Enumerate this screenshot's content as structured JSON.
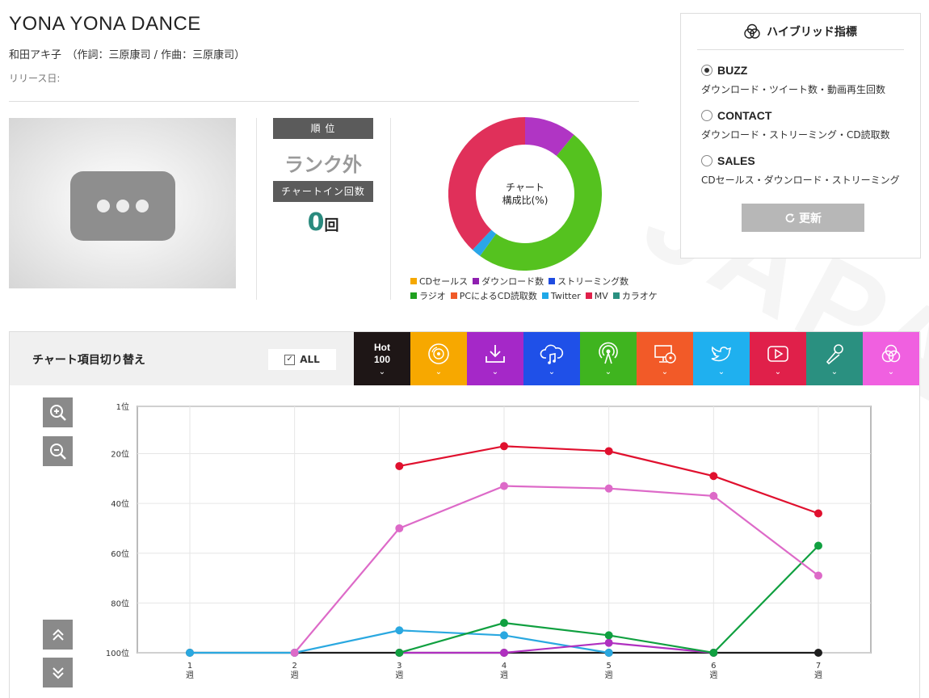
{
  "watermark": "JAPAN",
  "song": {
    "title": "YONA YONA DANCE",
    "credits": "和田アキ子　（作詞：三原康司 / 作曲：三原康司）",
    "release_label": "リリース日:"
  },
  "rank": {
    "header": "順 位",
    "value": "ランク外",
    "chartin_header": "チャートイン回数",
    "chartin_count": "0",
    "chartin_unit": "回"
  },
  "composition": {
    "center_line1": "チャート",
    "center_line2": "構成比(%)",
    "slices": [
      {
        "name": "ダウンロード数",
        "value": 11,
        "color": "#b035c4"
      },
      {
        "name": "ラジオ",
        "value": 49,
        "color": "#55c21f"
      },
      {
        "name": "Twitter",
        "value": 2,
        "color": "#2aa6e8"
      },
      {
        "name": "MV",
        "value": 38,
        "color": "#e0305a"
      }
    ],
    "legend": [
      [
        {
          "label": "CDセールス",
          "color": "#f5a800"
        },
        {
          "label": "ダウンロード数",
          "color": "#8f1fb0"
        },
        {
          "label": "ストリーミング数",
          "color": "#1f4ce0"
        }
      ],
      [
        {
          "label": "ラジオ",
          "color": "#1fa01f"
        },
        {
          "label": "PCによるCD読取数",
          "color": "#f05a28"
        },
        {
          "label": "Twitter",
          "color": "#1fa8e8"
        },
        {
          "label": "MV",
          "color": "#e0204a"
        },
        {
          "label": "カラオケ",
          "color": "#2a9080"
        }
      ]
    ]
  },
  "hybrid": {
    "title": "ハイブリッド指標",
    "options": [
      {
        "label": "BUZZ",
        "desc": "ダウンロード・ツイート数・動画再生回数",
        "selected": true
      },
      {
        "label": "CONTACT",
        "desc": "ダウンロード・ストリーミング・CD読取数",
        "selected": false
      },
      {
        "label": "SALES",
        "desc": "CDセールス・ダウンロード・ストリーミング",
        "selected": false
      }
    ],
    "update_label": "更新"
  },
  "switcher": {
    "label": "チャート項目切り替え",
    "all_label": "ALL",
    "hot_line1": "Hot",
    "hot_line2": "100",
    "tabs": [
      {
        "icon": "hot100-icon",
        "color": "#1e1616"
      },
      {
        "icon": "cd-icon",
        "color": "#f7a800"
      },
      {
        "icon": "download-icon",
        "color": "#a528c8"
      },
      {
        "icon": "streaming-icon",
        "color": "#1f50e8"
      },
      {
        "icon": "radio-icon",
        "color": "#3fb41f"
      },
      {
        "icon": "pc-cd-read-icon",
        "color": "#f25a28"
      },
      {
        "icon": "twitter-icon",
        "color": "#1fb0ef"
      },
      {
        "icon": "video-icon",
        "color": "#e0204a"
      },
      {
        "icon": "karaoke-icon",
        "color": "#2a9080"
      },
      {
        "icon": "hybrid-icon",
        "color": "#f060e0"
      }
    ]
  },
  "chart_data": {
    "type": "line",
    "x": [
      1,
      2,
      3,
      4,
      5,
      6,
      7
    ],
    "x_tick_labels": [
      "1\n週",
      "2\n週",
      "3\n週",
      "4\n週",
      "5\n週",
      "6\n週",
      "7\n週"
    ],
    "y_tick_labels": [
      "1位",
      "20位",
      "40位",
      "60位",
      "80位",
      "100位"
    ],
    "y_ticks": [
      1,
      20,
      40,
      60,
      80,
      100
    ],
    "ylim": [
      1,
      100
    ],
    "y_inverted": true,
    "grid": true,
    "series": [
      {
        "color": "#1e1e1e",
        "values": [
          100,
          100,
          100,
          100,
          100,
          100,
          100
        ]
      },
      {
        "color": "#2aa8e0",
        "values": [
          100,
          100,
          91,
          93,
          100,
          null,
          null
        ]
      },
      {
        "color": "#b030c0",
        "values": [
          null,
          null,
          100,
          100,
          96,
          100,
          null
        ]
      },
      {
        "color": "#10a040",
        "values": [
          null,
          null,
          100,
          88,
          93,
          100,
          57
        ]
      },
      {
        "color": "#dd6ac8",
        "values": [
          null,
          100,
          50,
          33,
          34,
          37,
          69
        ]
      },
      {
        "color": "#e0102e",
        "values": [
          null,
          null,
          25,
          17,
          19,
          29,
          44
        ]
      }
    ]
  }
}
